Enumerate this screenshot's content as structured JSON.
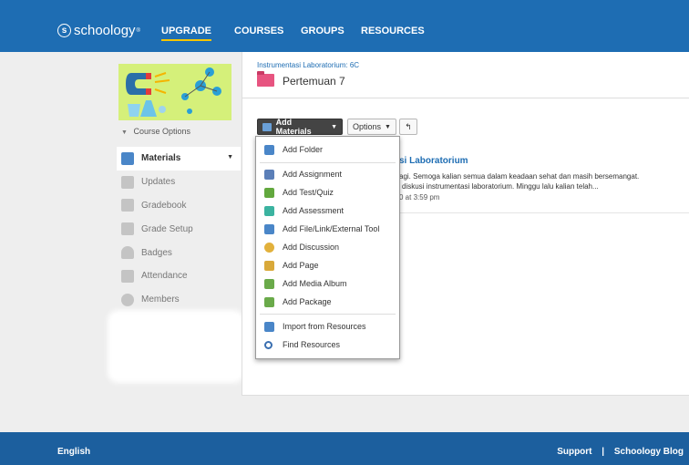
{
  "topnav": {
    "logo_text": "schoology",
    "logo_mark": "s",
    "tm": "®",
    "links": [
      "UPGRADE",
      "COURSES",
      "GROUPS",
      "RESOURCES"
    ]
  },
  "course": {
    "options_label": "Course Options",
    "nav": [
      {
        "label": "Materials",
        "icon": "materials-icon",
        "color": "#4a86c8"
      },
      {
        "label": "Updates",
        "icon": "updates-icon",
        "color": "#bbbbbb"
      },
      {
        "label": "Gradebook",
        "icon": "gradebook-icon",
        "color": "#bbbbbb"
      },
      {
        "label": "Grade Setup",
        "icon": "grade-setup-icon",
        "color": "#bbbbbb"
      },
      {
        "label": "Badges",
        "icon": "badges-icon",
        "color": "#bbbbbb"
      },
      {
        "label": "Attendance",
        "icon": "attendance-icon",
        "color": "#bbbbbb"
      },
      {
        "label": "Members",
        "icon": "members-icon",
        "color": "#bbbbbb"
      }
    ]
  },
  "main": {
    "breadcrumb": "Instrumentasi Laboratorium: 6C",
    "title": "Pertemuan 7",
    "add_materials_label": "Add Materials",
    "options_label": "Options",
    "back_glyph": "↰",
    "item": {
      "title": "si Laboratorium",
      "desc_line1": "agi. Semoga kalian semua dalam keadaan sehat dan masih bersemangat.",
      "desc_line2": "diskusi instrumentasi laboratorium. Minggu lalu kalian telah...",
      "time": "0 at 3:59 pm"
    }
  },
  "dropdown": {
    "groups": [
      [
        {
          "label": "Add Folder",
          "icon": "folder-icon",
          "color": "#4a86c8"
        }
      ],
      [
        {
          "label": "Add Assignment",
          "icon": "assignment-icon",
          "color": "#5b7fb8"
        },
        {
          "label": "Add Test/Quiz",
          "icon": "test-quiz-icon",
          "color": "#62a83e"
        },
        {
          "label": "Add Assessment",
          "icon": "assessment-icon",
          "color": "#3bb3a0"
        },
        {
          "label": "Add File/Link/External Tool",
          "icon": "file-link-icon",
          "color": "#4a86c8"
        },
        {
          "label": "Add Discussion",
          "icon": "discussion-icon",
          "color": "#e2b13c"
        },
        {
          "label": "Add Page",
          "icon": "page-icon",
          "color": "#d9a93a"
        },
        {
          "label": "Add Media Album",
          "icon": "media-album-icon",
          "color": "#6aaa4a"
        },
        {
          "label": "Add Package",
          "icon": "package-icon",
          "color": "#6aaa4a"
        }
      ],
      [
        {
          "label": "Import from Resources",
          "icon": "import-icon",
          "color": "#4a86c8"
        },
        {
          "label": "Find Resources",
          "icon": "search-icon",
          "color": "#3a6fb0"
        }
      ]
    ]
  },
  "footer": {
    "language": "English",
    "support": "Support",
    "separator": "|",
    "blog": "Schoology Blog"
  }
}
